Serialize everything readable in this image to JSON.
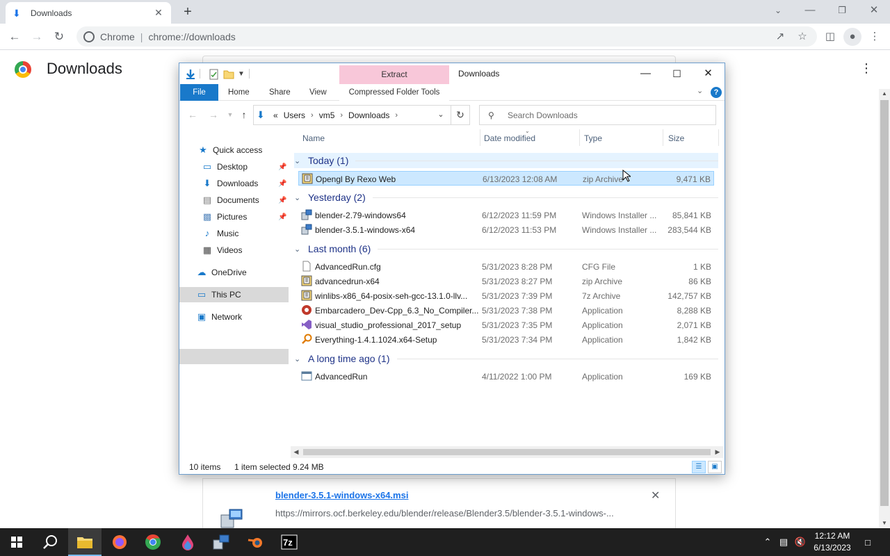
{
  "browser": {
    "tab_title": "Downloads",
    "omnibox_chip": "Chrome",
    "omnibox_url": "chrome://downloads"
  },
  "downloads_page": {
    "title": "Downloads",
    "card": {
      "filename": "blender-3.5.1-windows-x64.msi",
      "url": "https://mirrors.ocf.berkeley.edu/blender/release/Blender3.5/blender-3.5.1-windows-..."
    }
  },
  "explorer": {
    "title": "Downloads",
    "contextual_tab": "Extract",
    "ribbon_tabs": [
      "File",
      "Home",
      "Share",
      "View",
      "Compressed Folder Tools"
    ],
    "breadcrumb": {
      "prefix": "«",
      "parts": [
        "Users",
        "vm5",
        "Downloads"
      ]
    },
    "search_placeholder": "Search Downloads",
    "nav": [
      {
        "label": "Quick access",
        "icon": "star-icon"
      },
      {
        "label": "Desktop",
        "icon": "desktop-icon",
        "pinned": true
      },
      {
        "label": "Downloads",
        "icon": "download-icon",
        "pinned": true
      },
      {
        "label": "Documents",
        "icon": "document-icon",
        "pinned": true
      },
      {
        "label": "Pictures",
        "icon": "pictures-icon",
        "pinned": true
      },
      {
        "label": "Music",
        "icon": "music-icon"
      },
      {
        "label": "Videos",
        "icon": "videos-icon"
      },
      {
        "label": "OneDrive",
        "icon": "cloud-icon"
      },
      {
        "label": "This PC",
        "icon": "computer-icon",
        "selected": true
      },
      {
        "label": "Network",
        "icon": "network-icon"
      }
    ],
    "columns": [
      "Name",
      "Date modified",
      "Type",
      "Size"
    ],
    "groups": [
      {
        "label": "Today (1)",
        "rows": [
          {
            "name": "Opengl By Rexo Web",
            "date": "6/13/2023 12:08 AM",
            "type": "zip Archive",
            "size": "9,471 KB",
            "selected": true,
            "icon": "zip-icon"
          }
        ]
      },
      {
        "label": "Yesterday (2)",
        "rows": [
          {
            "name": "blender-2.79-windows64",
            "date": "6/12/2023 11:59 PM",
            "type": "Windows Installer ...",
            "size": "85,841 KB",
            "icon": "installer-icon"
          },
          {
            "name": "blender-3.5.1-windows-x64",
            "date": "6/12/2023 11:53 PM",
            "type": "Windows Installer ...",
            "size": "283,544 KB",
            "icon": "installer-icon"
          }
        ]
      },
      {
        "label": "Last month (6)",
        "rows": [
          {
            "name": "AdvancedRun.cfg",
            "date": "5/31/2023 8:28 PM",
            "type": "CFG File",
            "size": "1 KB",
            "icon": "file-icon"
          },
          {
            "name": "advancedrun-x64",
            "date": "5/31/2023 8:27 PM",
            "type": "zip Archive",
            "size": "86 KB",
            "icon": "zip-icon"
          },
          {
            "name": "winlibs-x86_64-posix-seh-gcc-13.1.0-llv...",
            "date": "5/31/2023 7:39 PM",
            "type": "7z Archive",
            "size": "142,757 KB",
            "icon": "zip-icon"
          },
          {
            "name": "Embarcadero_Dev-Cpp_6.3_No_Compiler...",
            "date": "5/31/2023 7:38 PM",
            "type": "Application",
            "size": "8,288 KB",
            "icon": "devcpp-icon"
          },
          {
            "name": "visual_studio_professional_2017_setup",
            "date": "5/31/2023 7:35 PM",
            "type": "Application",
            "size": "2,071 KB",
            "icon": "visual-studio-icon"
          },
          {
            "name": "Everything-1.4.1.1024.x64-Setup",
            "date": "5/31/2023 7:34 PM",
            "type": "Application",
            "size": "1,842 KB",
            "icon": "everything-icon"
          }
        ]
      },
      {
        "label": "A long time ago (1)",
        "rows": [
          {
            "name": "AdvancedRun",
            "date": "4/11/2022 1:00 PM",
            "type": "Application",
            "size": "169 KB",
            "icon": "app-window-icon"
          }
        ]
      }
    ],
    "status": {
      "items": "10 items",
      "selected": "1 item selected",
      "size": "9.24 MB"
    }
  },
  "taskbar": {
    "clock_time": "12:12 AM",
    "clock_date": "6/13/2023"
  },
  "colors": {
    "explorer_accent": "#1979ca",
    "selection": "#cce8ff",
    "extract_tab": "#f8c7d9",
    "link": "#1a73e8"
  }
}
